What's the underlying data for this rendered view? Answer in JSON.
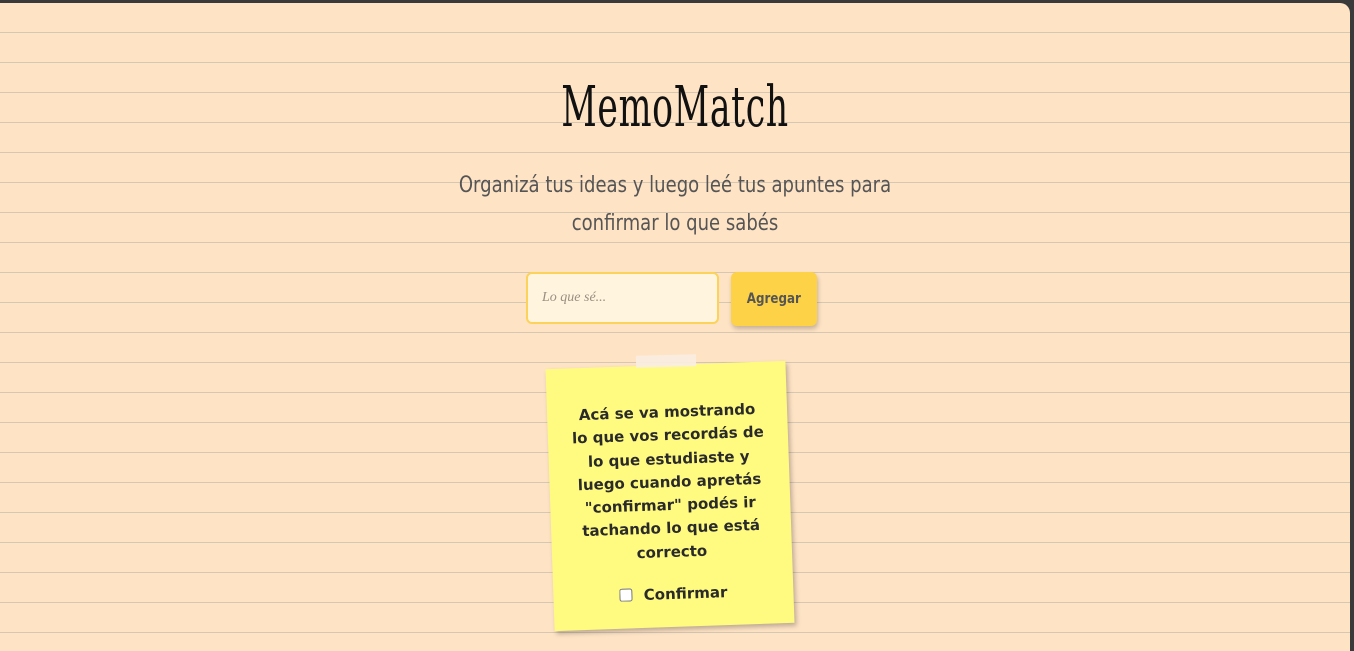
{
  "app": {
    "title": "MemoMatch",
    "subtitle": "Organizá tus ideas y luego leé tus apuntes para confirmar lo que sabés"
  },
  "form": {
    "input_placeholder": "Lo que sé...",
    "input_value": "",
    "add_button_label": "Agregar"
  },
  "note": {
    "text": "Acá se va mostrando lo que vos recordás de lo que estudiaste y luego cuando apretás \"confirmar\" podés ir tachando lo que está correcto",
    "confirm_label": "Confirmar",
    "confirm_checked": false
  },
  "colors": {
    "background": "#fee3c5",
    "note": "#fffb80",
    "button": "#fdd246",
    "input_border": "#fcd25a"
  }
}
